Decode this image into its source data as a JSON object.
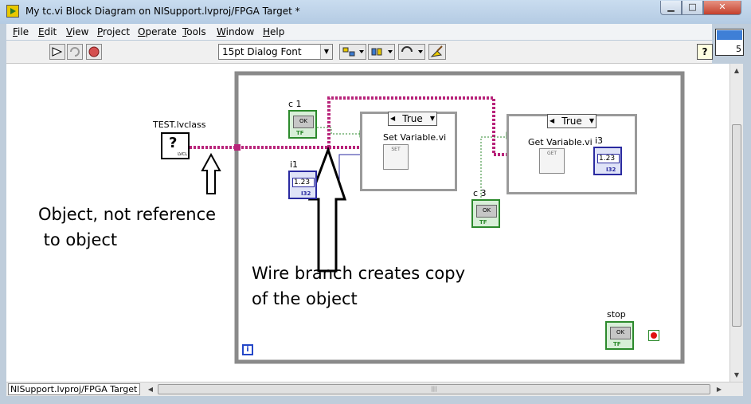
{
  "window": {
    "title": "My tc.vi Block Diagram on NISupport.lvproj/FPGA Target *",
    "controls": {
      "minimize": "▁",
      "maximize": "□",
      "close": "✕"
    }
  },
  "menu": [
    {
      "label": "File",
      "key": "F"
    },
    {
      "label": "Edit",
      "key": "E"
    },
    {
      "label": "View",
      "key": "V"
    },
    {
      "label": "Project",
      "key": "P"
    },
    {
      "label": "Operate",
      "key": "O"
    },
    {
      "label": "Tools",
      "key": "T"
    },
    {
      "label": "Window",
      "key": "W"
    },
    {
      "label": "Help",
      "key": "H"
    }
  ],
  "toolbar": {
    "font": "15pt Dialog Font",
    "help_glyph": "?",
    "palette_number": "5"
  },
  "diagram": {
    "class_constant": "TEST.lvclass",
    "class_const_tag": "LVCL",
    "labels": {
      "c1": "c 1",
      "i1": "i1",
      "c3": "c 3",
      "i3": "i3",
      "stop": "stop"
    },
    "case1": {
      "selector": "True",
      "subvi": "Set Variable.vi",
      "subvi_glyph": "SET"
    },
    "case2": {
      "selector": "True",
      "subvi": "Get Variable.vi",
      "subvi_glyph": "GET"
    },
    "ok_text": "OK",
    "tf_text": "TF",
    "num_value": "1.23",
    "i32_text": "I32",
    "info_glyph": "i",
    "annotations": {
      "object_line1": "Object, not reference",
      "object_line2": " to object",
      "branch_line1": "Wire branch creates copy",
      "branch_line2": "of the object"
    },
    "wire_colors": {
      "class": "#b8247a",
      "boolean": "#2c8a2c",
      "numeric": "#2a2aa0"
    }
  },
  "status": {
    "path": "NISupport.lvproj/FPGA Target"
  }
}
